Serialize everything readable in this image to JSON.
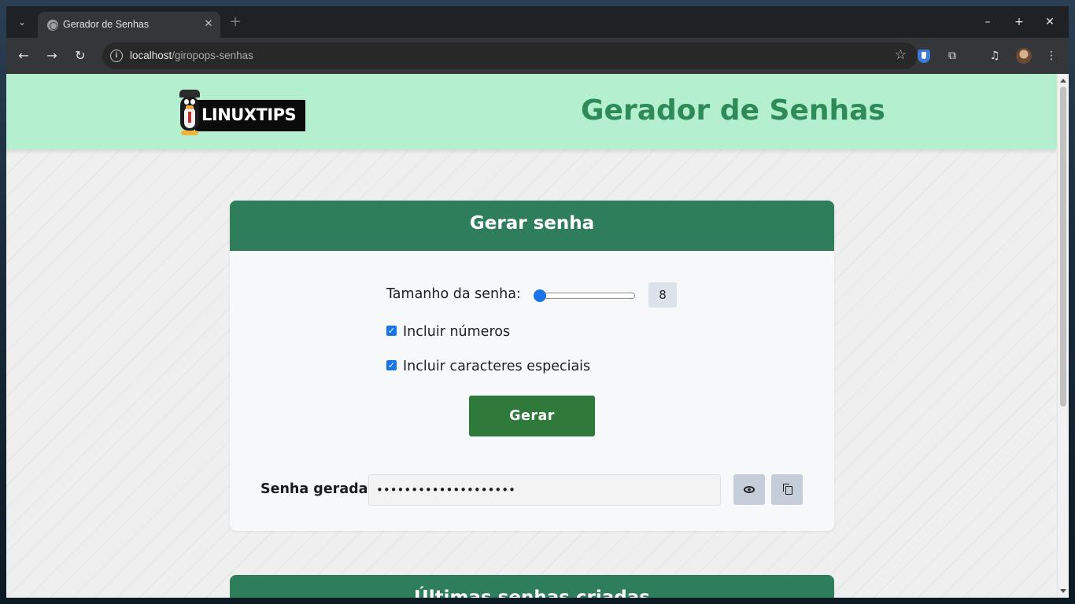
{
  "browser": {
    "tab_title": "Gerador de Senhas",
    "new_tab": "+",
    "url_host": "localhost",
    "url_path": "/giropops-senhas",
    "window_controls": {
      "minimize": "–",
      "maximize": "+",
      "close": "✕"
    }
  },
  "icons": {
    "tab_search": "chevron-down-icon",
    "back": "arrow-left-icon",
    "forward": "arrow-right-icon",
    "reload": "reload-icon",
    "site_info": "info-icon",
    "bookmark": "star-icon",
    "extensions": "puzzle-icon",
    "media": "media-queue-icon",
    "menu": "kebab-menu-icon"
  },
  "header": {
    "logo_text": "LINUXTIPS",
    "title": "Gerador de Senhas"
  },
  "generator": {
    "card_title": "Gerar senha",
    "length_label": "Tamanho da senha:",
    "length_value": "8",
    "length_slider_fraction": 0.0,
    "include_numbers_label": "Incluir números",
    "include_numbers_checked": true,
    "include_special_label": "Incluir caracteres especiais",
    "include_special_checked": true,
    "generate_button": "Gerar",
    "generated_label": "Senha gerada:",
    "generated_value": "••••••••••••••••••••"
  },
  "history": {
    "card_title": "Últimas senhas criadas"
  },
  "colors": {
    "header_bg": "#b4f0d0",
    "title_green": "#2e8b57",
    "card_head_green": "#2e7d5b",
    "button_green": "#2f7a3a",
    "accent_blue": "#1a73e8"
  }
}
